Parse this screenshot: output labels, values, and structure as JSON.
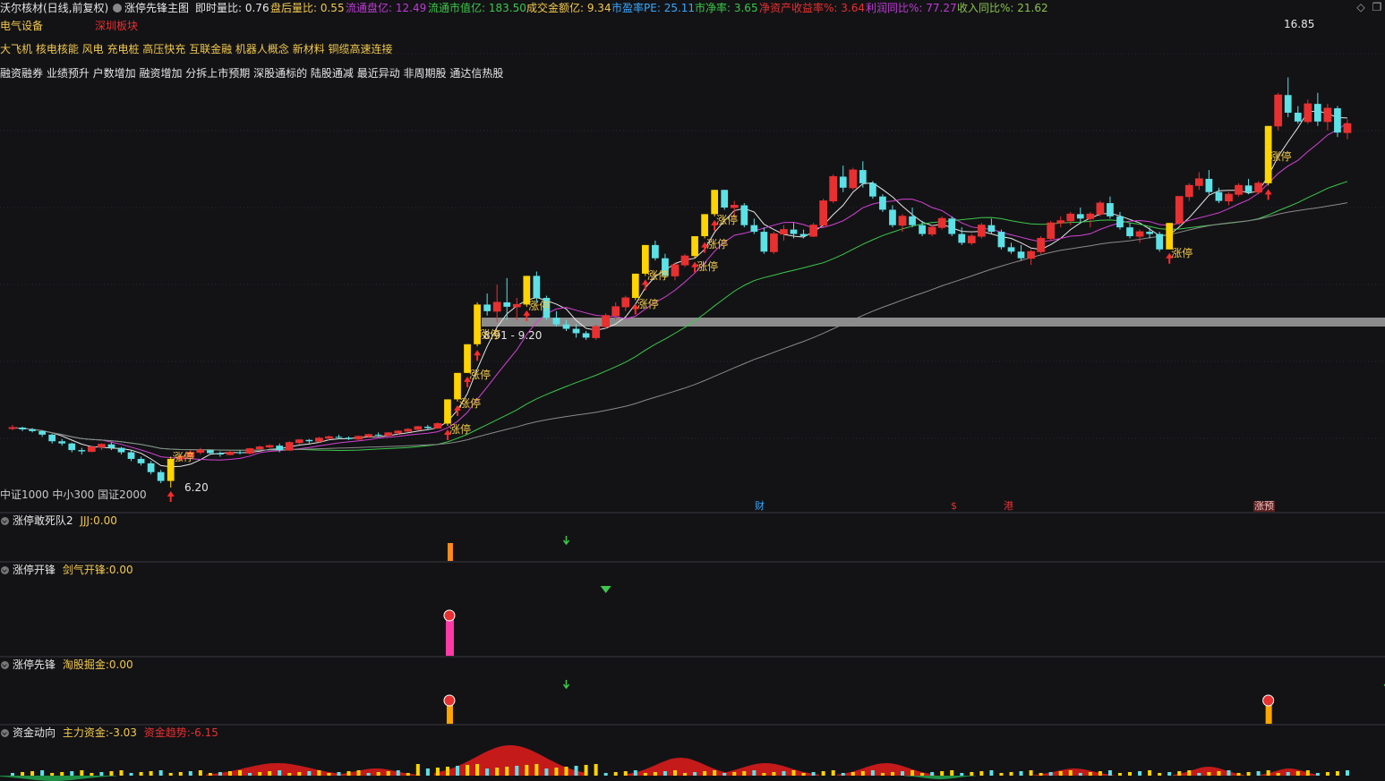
{
  "header": {
    "stock_name": "沃尔核材(日线,前复权)",
    "indicator_name": "涨停先锋主图",
    "metrics": [
      {
        "label": "即时量比:",
        "value": "0.76",
        "color": "#e6e6e6"
      },
      {
        "label": "盘后量比:",
        "value": "0.55",
        "color": "#f2c94c"
      },
      {
        "label": "流通盘亿:",
        "value": "12.49",
        "color": "#c03ad6"
      },
      {
        "label": "流通市值亿:",
        "value": "183.50",
        "color": "#3cc84a"
      },
      {
        "label": "成交金额亿:",
        "value": "9.34",
        "color": "#f2c94c"
      },
      {
        "label": "市盈率PE:",
        "value": "25.11",
        "color": "#38a8ff"
      },
      {
        "label": "市净率:",
        "value": "3.65",
        "color": "#3cc84a"
      },
      {
        "label": "净资产收益率%:",
        "value": "3.64",
        "color": "#e83030"
      },
      {
        "label": "利润同比%:",
        "value": "77.27",
        "color": "#c03ad6"
      },
      {
        "label": "收入同比%:",
        "value": "21.62",
        "color": "#8bc34a"
      }
    ]
  },
  "sector": {
    "industry": "电气设备",
    "region": "深圳板块"
  },
  "concepts_row1": "大飞机 核电核能 风电 充电桩 高压快充 互联金融 机器人概念 新材料 铜缆高速连接",
  "concepts_row2": "融资融券 业绩预升 户数增加 融资增加 分拆上市预期 深股通标的 陆股通减 最近异动 非周期股 通达信热股",
  "index_membership": "中证1000 中小300 国证2000",
  "price_band_label": "8.91 - 9.20",
  "high_label": "16.85",
  "low_label": "6.20",
  "limit_up_label": "涨停",
  "event_flags": [
    {
      "text": "财",
      "color": "#38a8ff"
    },
    {
      "text": "$",
      "color": "#e83030"
    },
    {
      "text": "港",
      "color": "#e83030"
    },
    {
      "text": "涨预",
      "color": "#e83030"
    }
  ],
  "panes": [
    {
      "title": "涨停敢死队2",
      "metric_label": "JJJ:",
      "metric_value": "0.00"
    },
    {
      "title": "涨停开锋",
      "metric_label": "剑气开锋:",
      "metric_value": "0.00"
    },
    {
      "title": "涨停先锋",
      "metric_label": "淘股掘金:",
      "metric_value": "0.00"
    },
    {
      "title": "资金动向",
      "metric_label": "主力资金:",
      "metric_value": "-3.03",
      "metric2_label": "资金趋势:",
      "metric2_value": "-6.15"
    }
  ],
  "icons": {
    "menu": "diamond-menu-icon",
    "window": "window-restore-icon",
    "pane_toggle": "collapse-icon"
  },
  "colors": {
    "up": "#e83030",
    "down": "#5ce1e6",
    "limit_up": "#ffd400",
    "ma5": "#e6e6e6",
    "ma10": "#d442d4",
    "ma30": "#3cc84a",
    "ma60": "#8a8a8a"
  },
  "chart_data": {
    "type": "candlestick",
    "y_range_visible": [
      6.2,
      16.85
    ],
    "price_band": [
      8.91,
      9.2
    ],
    "candles": [
      [
        7.55,
        7.62,
        7.5,
        7.56
      ],
      [
        7.56,
        7.58,
        7.48,
        7.52
      ],
      [
        7.52,
        7.55,
        7.45,
        7.48
      ],
      [
        7.48,
        7.5,
        7.35,
        7.4
      ],
      [
        7.4,
        7.42,
        7.2,
        7.25
      ],
      [
        7.25,
        7.3,
        7.15,
        7.2
      ],
      [
        7.2,
        7.22,
        7.0,
        7.05
      ],
      [
        7.05,
        7.1,
        6.95,
        7.02
      ],
      [
        7.02,
        7.15,
        7.0,
        7.12
      ],
      [
        7.12,
        7.2,
        7.05,
        7.18
      ],
      [
        7.18,
        7.22,
        7.05,
        7.1
      ],
      [
        7.1,
        7.12,
        6.95,
        7.0
      ],
      [
        7.0,
        7.05,
        6.8,
        6.85
      ],
      [
        6.85,
        6.9,
        6.7,
        6.75
      ],
      [
        6.75,
        6.8,
        6.5,
        6.55
      ],
      [
        6.55,
        6.6,
        6.3,
        6.35
      ],
      [
        6.35,
        6.9,
        6.2,
        6.85
      ],
      [
        6.85,
        6.95,
        6.8,
        6.9
      ],
      [
        6.9,
        7.05,
        6.85,
        7.0
      ],
      [
        7.0,
        7.1,
        6.95,
        7.05
      ],
      [
        7.05,
        7.05,
        6.95,
        6.98
      ],
      [
        6.98,
        7.02,
        6.9,
        6.95
      ],
      [
        6.95,
        7.05,
        6.93,
        7.0
      ],
      [
        7.0,
        7.05,
        6.95,
        6.98
      ],
      [
        6.98,
        7.1,
        6.95,
        7.08
      ],
      [
        7.08,
        7.15,
        7.05,
        7.12
      ],
      [
        7.12,
        7.18,
        7.1,
        7.15
      ],
      [
        7.15,
        7.2,
        7.0,
        7.05
      ],
      [
        7.05,
        7.25,
        7.03,
        7.22
      ],
      [
        7.22,
        7.3,
        7.18,
        7.28
      ],
      [
        7.28,
        7.3,
        7.2,
        7.25
      ],
      [
        7.25,
        7.35,
        7.22,
        7.32
      ],
      [
        7.32,
        7.38,
        7.28,
        7.35
      ],
      [
        7.35,
        7.4,
        7.3,
        7.33
      ],
      [
        7.33,
        7.36,
        7.28,
        7.3
      ],
      [
        7.3,
        7.38,
        7.28,
        7.36
      ],
      [
        7.36,
        7.42,
        7.33,
        7.4
      ],
      [
        7.4,
        7.45,
        7.35,
        7.38
      ],
      [
        7.38,
        7.46,
        7.36,
        7.44
      ],
      [
        7.44,
        7.5,
        7.4,
        7.48
      ],
      [
        7.48,
        7.55,
        7.45,
        7.52
      ],
      [
        7.52,
        7.6,
        7.5,
        7.58
      ],
      [
        7.58,
        7.62,
        7.5,
        7.55
      ],
      [
        7.55,
        7.68,
        7.53,
        7.65
      ],
      [
        7.65,
        8.2,
        7.6,
        8.2
      ],
      [
        8.2,
        8.8,
        8.15,
        8.8
      ],
      [
        8.8,
        9.45,
        8.8,
        9.45
      ],
      [
        9.45,
        10.4,
        9.4,
        10.35
      ],
      [
        10.35,
        10.6,
        10.1,
        10.2
      ],
      [
        10.2,
        10.8,
        9.95,
        10.4
      ],
      [
        10.4,
        10.95,
        10.0,
        10.3
      ],
      [
        10.3,
        10.5,
        10.0,
        10.35
      ],
      [
        10.35,
        11.0,
        10.3,
        11.0
      ],
      [
        11.0,
        11.1,
        10.4,
        10.5
      ],
      [
        10.5,
        10.55,
        10.0,
        10.05
      ],
      [
        10.05,
        10.2,
        9.85,
        9.9
      ],
      [
        9.9,
        10.0,
        9.75,
        9.8
      ],
      [
        9.8,
        9.9,
        9.6,
        9.7
      ],
      [
        9.7,
        9.75,
        9.55,
        9.6
      ],
      [
        9.6,
        9.9,
        9.55,
        9.85
      ],
      [
        9.85,
        10.15,
        9.8,
        10.1
      ],
      [
        10.1,
        10.4,
        10.0,
        10.3
      ],
      [
        10.3,
        10.55,
        10.2,
        10.5
      ],
      [
        10.5,
        11.05,
        10.45,
        11.05
      ],
      [
        11.05,
        11.7,
        11.0,
        11.7
      ],
      [
        11.7,
        11.8,
        11.35,
        11.4
      ],
      [
        11.4,
        11.5,
        10.95,
        11.0
      ],
      [
        11.0,
        11.3,
        10.9,
        11.25
      ],
      [
        11.25,
        11.5,
        11.2,
        11.45
      ],
      [
        11.45,
        11.9,
        11.4,
        11.9
      ],
      [
        11.9,
        12.4,
        11.85,
        12.4
      ],
      [
        12.4,
        12.95,
        12.35,
        12.95
      ],
      [
        12.95,
        12.95,
        12.5,
        12.55
      ],
      [
        12.55,
        12.7,
        12.3,
        12.6
      ],
      [
        12.6,
        12.65,
        12.1,
        12.15
      ],
      [
        12.15,
        12.3,
        11.95,
        12.0
      ],
      [
        12.0,
        12.1,
        11.5,
        11.55
      ],
      [
        11.55,
        12.0,
        11.5,
        11.95
      ],
      [
        11.95,
        12.15,
        11.8,
        12.05
      ],
      [
        12.05,
        12.2,
        11.85,
        11.95
      ],
      [
        11.95,
        12.05,
        11.85,
        11.9
      ],
      [
        11.9,
        12.2,
        11.88,
        12.15
      ],
      [
        12.15,
        12.75,
        12.1,
        12.7
      ],
      [
        12.7,
        13.3,
        12.65,
        13.25
      ],
      [
        13.25,
        13.5,
        12.9,
        13.0
      ],
      [
        13.0,
        13.45,
        12.95,
        13.4
      ],
      [
        13.4,
        13.6,
        13.0,
        13.1
      ],
      [
        13.1,
        13.15,
        12.75,
        12.8
      ],
      [
        12.8,
        12.85,
        12.45,
        12.5
      ],
      [
        12.5,
        12.6,
        12.1,
        12.15
      ],
      [
        12.15,
        12.4,
        12.0,
        12.35
      ],
      [
        12.35,
        12.55,
        12.1,
        12.15
      ],
      [
        12.15,
        12.25,
        11.9,
        11.95
      ],
      [
        11.95,
        12.15,
        11.9,
        12.1
      ],
      [
        12.1,
        12.35,
        12.05,
        12.3
      ],
      [
        12.3,
        12.35,
        11.9,
        11.95
      ],
      [
        11.95,
        12.1,
        11.7,
        11.75
      ],
      [
        11.75,
        11.95,
        11.7,
        11.9
      ],
      [
        11.9,
        12.2,
        11.85,
        12.15
      ],
      [
        12.15,
        12.3,
        11.95,
        12.0
      ],
      [
        12.0,
        12.05,
        11.6,
        11.65
      ],
      [
        11.65,
        11.75,
        11.5,
        11.55
      ],
      [
        11.55,
        11.7,
        11.35,
        11.4
      ],
      [
        11.4,
        11.6,
        11.25,
        11.55
      ],
      [
        11.55,
        11.9,
        11.5,
        11.85
      ],
      [
        11.85,
        12.25,
        11.8,
        12.2
      ],
      [
        12.2,
        12.35,
        12.1,
        12.25
      ],
      [
        12.25,
        12.45,
        12.15,
        12.4
      ],
      [
        12.4,
        12.55,
        12.2,
        12.3
      ],
      [
        12.3,
        12.45,
        12.1,
        12.4
      ],
      [
        12.4,
        12.7,
        12.35,
        12.65
      ],
      [
        12.65,
        12.8,
        12.3,
        12.35
      ],
      [
        12.35,
        12.45,
        12.05,
        12.1
      ],
      [
        12.1,
        12.2,
        11.85,
        11.9
      ],
      [
        11.9,
        12.05,
        11.75,
        12.0
      ],
      [
        12.0,
        12.1,
        11.85,
        11.95
      ],
      [
        11.95,
        12.0,
        11.55,
        11.6
      ],
      [
        11.6,
        12.2,
        11.6,
        12.2
      ],
      [
        12.2,
        12.8,
        12.15,
        12.8
      ],
      [
        12.8,
        13.1,
        12.7,
        13.05
      ],
      [
        13.05,
        13.35,
        12.95,
        13.2
      ],
      [
        13.2,
        13.4,
        12.85,
        12.9
      ],
      [
        12.9,
        13.0,
        12.65,
        12.7
      ],
      [
        12.7,
        12.9,
        12.6,
        12.85
      ],
      [
        12.85,
        13.1,
        12.8,
        13.05
      ],
      [
        13.05,
        13.2,
        12.85,
        12.9
      ],
      [
        12.9,
        13.15,
        12.85,
        13.1
      ],
      [
        13.1,
        14.4,
        13.05,
        14.4
      ],
      [
        14.4,
        15.15,
        14.3,
        15.1
      ],
      [
        15.1,
        15.5,
        14.6,
        14.7
      ],
      [
        14.7,
        14.85,
        14.45,
        14.5
      ],
      [
        14.5,
        15.0,
        14.45,
        14.9
      ],
      [
        14.9,
        15.15,
        14.4,
        14.5
      ],
      [
        14.5,
        14.9,
        14.3,
        14.8
      ],
      [
        14.8,
        14.85,
        14.15,
        14.25
      ],
      [
        14.25,
        14.55,
        14.1,
        14.45
      ]
    ],
    "limit_up_days": [
      16,
      44,
      45,
      46,
      47,
      52,
      63,
      64,
      69,
      70,
      71,
      117,
      127
    ],
    "indicator_pane": {
      "type": "bar+area",
      "name": "资金动向",
      "main": -3.03,
      "trend": -6.15
    }
  }
}
